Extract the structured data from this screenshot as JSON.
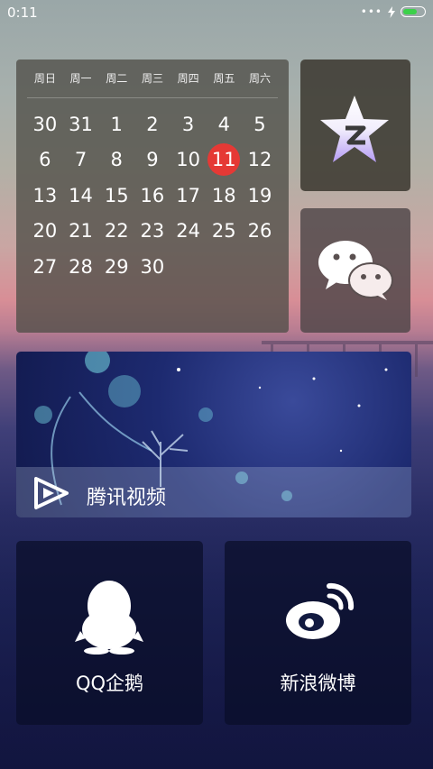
{
  "status_bar": {
    "time": "0:11",
    "signal_dots": "•••",
    "battery_level_pct": 70
  },
  "calendar": {
    "weekdays": [
      "周日",
      "周一",
      "周二",
      "周三",
      "周四",
      "周五",
      "周六"
    ],
    "days": [
      "30",
      "31",
      "1",
      "2",
      "3",
      "4",
      "5",
      "6",
      "7",
      "8",
      "9",
      "10",
      "11",
      "12",
      "13",
      "14",
      "15",
      "16",
      "17",
      "18",
      "19",
      "20",
      "21",
      "22",
      "23",
      "24",
      "25",
      "26",
      "27",
      "28",
      "29",
      "30"
    ],
    "today": "11"
  },
  "apps": {
    "qzone": {
      "icon": "qzone-star-icon"
    },
    "wechat": {
      "icon": "wechat-icon"
    },
    "tencent_video": {
      "label": "腾讯视频",
      "icon": "tencent-video-play-icon"
    },
    "qq": {
      "label": "QQ企鹅",
      "icon": "qq-penguin-icon"
    },
    "weibo": {
      "label": "新浪微博",
      "icon": "weibo-eye-icon"
    }
  },
  "colors": {
    "today_highlight": "#e53935",
    "battery": "#3bd14a"
  }
}
